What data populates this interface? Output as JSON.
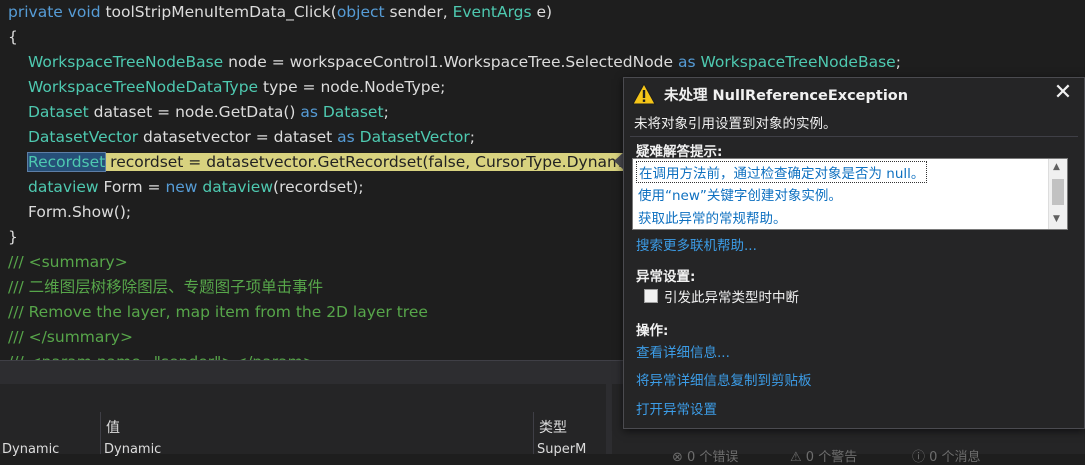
{
  "editor": {
    "lines": [
      {
        "kw1": "private void",
        "rest": " toolStripMenuItemData_Click(",
        "kw2": "object",
        "rest2": " sender, ",
        "ty": "EventArgs",
        "rest3": " e)"
      },
      {
        "text": "{"
      },
      {
        "ty1": "WorkspaceTreeNodeBase",
        "mid": " node = workspaceControl1.WorkspaceTree.SelectedNode ",
        "kw": "as",
        "ty2": " WorkspaceTreeNodeBase",
        "end": ";"
      },
      {
        "ty1": "WorkspaceTreeNodeDataType",
        "mid": " type = node.NodeType;"
      },
      {
        "ty1": "Dataset",
        "mid": " dataset = node.GetData() ",
        "kw": "as",
        "ty2": " Dataset",
        "end": ";"
      },
      {
        "ty1": "DatasetVector",
        "mid": " datasetvector = dataset ",
        "kw": "as",
        "ty2": " DatasetVector",
        "end": ";"
      },
      {
        "word": "Recordset",
        "stmt": " recordset = datasetvector.GetRecordset(false, CursorType.Dynamic);"
      },
      {
        "ty1": "dataview",
        "mid": " Form = ",
        "kw": "new",
        "ty2": " dataview",
        "end": "(recordset);"
      },
      {
        "text": "Form.Show();"
      },
      {
        "text": "}"
      },
      {
        "text": "/// <summary>"
      },
      {
        "text": "/// 二维图层树移除图层、专题图子项单击事件"
      },
      {
        "text": "/// Remove the layer, map item from the 2D layer tree"
      },
      {
        "text": "/// </summary>"
      },
      {
        "text": "/// <param name=\"sender\"></param>"
      }
    ]
  },
  "locals": {
    "col_value": "值",
    "col_type": "类型",
    "row": {
      "name": "Dynamic",
      "value": "Dynamic",
      "type": "SuperM"
    },
    "pin_icon": "pin-icon",
    "dropdown_icon": "chevron-down-icon",
    "close_icon": "close-icon"
  },
  "error_list": {
    "errors": "0 个错误",
    "warnings": "0 个警告",
    "messages": "0 个消息"
  },
  "exception": {
    "title": "未处理 NullReferenceException",
    "message": "未将对象引用设置到对象的实例。",
    "tips_heading": "疑难解答提示:",
    "tips": [
      "在调用方法前，通过检查确定对象是否为 null。",
      "使用“new”关键字创建对象实例。",
      "获取此异常的常规帮助。"
    ],
    "search_link": "搜索更多联机帮助...",
    "settings_heading": "异常设置:",
    "break_label": "引发此异常类型时中断",
    "actions_heading": "操作:",
    "actions": [
      "查看详细信息...",
      "将异常详细信息复制到剪贴板",
      "打开异常设置"
    ],
    "warning_color": "#f5c518",
    "link_color": "#3c9ce6"
  }
}
